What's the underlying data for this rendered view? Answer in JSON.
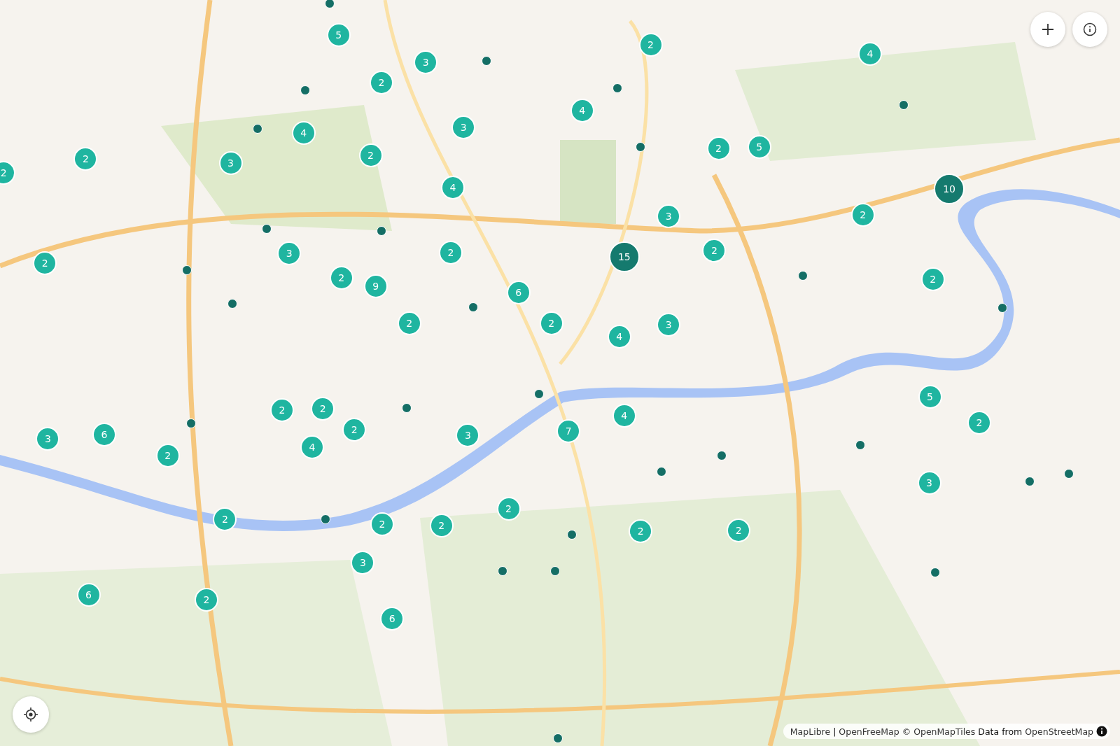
{
  "markers": [
    {
      "kind": "cluster",
      "count": "5"
    },
    {
      "kind": "cluster",
      "count": "3"
    },
    {
      "kind": "cluster",
      "count": "2"
    },
    {
      "kind": "cluster",
      "count": "2"
    },
    {
      "kind": "cluster",
      "count": "4"
    },
    {
      "kind": "cluster",
      "count": "4"
    },
    {
      "kind": "cluster",
      "count": "3"
    },
    {
      "kind": "cluster",
      "count": "4"
    },
    {
      "kind": "cluster",
      "count": "2"
    },
    {
      "kind": "cluster",
      "count": "3"
    },
    {
      "kind": "cluster",
      "count": "2"
    },
    {
      "kind": "cluster",
      "count": "2"
    },
    {
      "kind": "cluster",
      "count": "2"
    },
    {
      "kind": "cluster",
      "count": "5"
    },
    {
      "kind": "cluster",
      "count": "4"
    },
    {
      "kind": "large_cluster",
      "count": "10"
    },
    {
      "kind": "cluster",
      "count": "2"
    },
    {
      "kind": "cluster",
      "count": "3"
    },
    {
      "kind": "cluster",
      "count": "3"
    },
    {
      "kind": "cluster",
      "count": "2"
    },
    {
      "kind": "large_cluster",
      "count": "15"
    },
    {
      "kind": "cluster",
      "count": "2"
    },
    {
      "kind": "cluster",
      "count": "2"
    },
    {
      "kind": "cluster",
      "count": "2"
    },
    {
      "kind": "cluster",
      "count": "9"
    },
    {
      "kind": "cluster",
      "count": "6"
    },
    {
      "kind": "cluster",
      "count": "2"
    },
    {
      "kind": "cluster",
      "count": "2"
    },
    {
      "kind": "cluster",
      "count": "2"
    },
    {
      "kind": "cluster",
      "count": "4"
    },
    {
      "kind": "cluster",
      "count": "3"
    },
    {
      "kind": "cluster",
      "count": "2"
    },
    {
      "kind": "cluster",
      "count": "2"
    },
    {
      "kind": "cluster",
      "count": "2"
    },
    {
      "kind": "cluster",
      "count": "5"
    },
    {
      "kind": "cluster",
      "count": "2"
    },
    {
      "kind": "cluster",
      "count": "3"
    },
    {
      "kind": "cluster",
      "count": "6"
    },
    {
      "kind": "cluster",
      "count": "2"
    },
    {
      "kind": "cluster",
      "count": "4"
    },
    {
      "kind": "cluster",
      "count": "3"
    },
    {
      "kind": "cluster",
      "count": "7"
    },
    {
      "kind": "cluster",
      "count": "4"
    },
    {
      "kind": "cluster",
      "count": "3"
    },
    {
      "kind": "cluster",
      "count": "2"
    },
    {
      "kind": "cluster",
      "count": "2"
    },
    {
      "kind": "cluster",
      "count": "2"
    },
    {
      "kind": "cluster",
      "count": "2"
    },
    {
      "kind": "cluster",
      "count": "2"
    },
    {
      "kind": "cluster",
      "count": "2"
    },
    {
      "kind": "cluster",
      "count": "3"
    },
    {
      "kind": "cluster",
      "count": "6"
    },
    {
      "kind": "cluster",
      "count": "2"
    },
    {
      "kind": "cluster",
      "count": "6"
    },
    {
      "kind": "point"
    },
    {
      "kind": "point"
    },
    {
      "kind": "point"
    },
    {
      "kind": "point"
    },
    {
      "kind": "point"
    },
    {
      "kind": "point"
    },
    {
      "kind": "point"
    },
    {
      "kind": "point"
    },
    {
      "kind": "point"
    },
    {
      "kind": "point"
    },
    {
      "kind": "point"
    },
    {
      "kind": "point"
    },
    {
      "kind": "point"
    },
    {
      "kind": "point"
    },
    {
      "kind": "point"
    },
    {
      "kind": "point"
    },
    {
      "kind": "point"
    },
    {
      "kind": "point"
    },
    {
      "kind": "point"
    },
    {
      "kind": "point"
    },
    {
      "kind": "point"
    },
    {
      "kind": "point"
    },
    {
      "kind": "point"
    },
    {
      "kind": "point"
    },
    {
      "kind": "point"
    },
    {
      "kind": "point"
    },
    {
      "kind": "point"
    },
    {
      "kind": "point"
    }
  ],
  "attribution": [
    {
      "kind": "link",
      "text": "MapLibre"
    },
    {
      "kind": "text",
      "text": "|"
    },
    {
      "kind": "link",
      "text": "OpenFreeMap"
    },
    {
      "kind": "text",
      "text": "©"
    },
    {
      "kind": "link",
      "text": "OpenMapTiles"
    },
    {
      "kind": "text",
      "text": "Data from"
    },
    {
      "kind": "link",
      "text": "OpenStreetMap"
    }
  ]
}
